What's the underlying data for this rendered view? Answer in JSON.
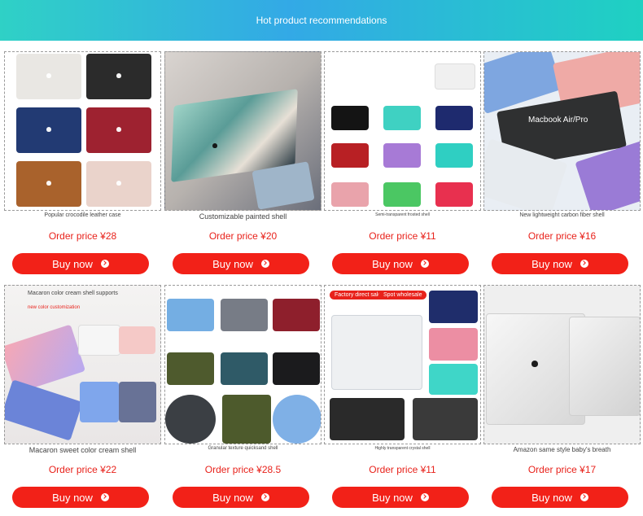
{
  "banner": {
    "title": "Hot product recommendations"
  },
  "products": [
    {
      "caption": "Popular crocodile leather case",
      "price": "Order price ¥28",
      "button": "Buy now"
    },
    {
      "caption": "Customizable painted shell",
      "price": "Order price ¥20",
      "button": "Buy now"
    },
    {
      "caption": "Semi-transparent frosted shell",
      "price": "Order price ¥11",
      "button": "Buy now"
    },
    {
      "caption": "New lightweight carbon fiber shell",
      "price": "Order price ¥16",
      "button": "Buy now"
    },
    {
      "caption": "Macaron sweet color cream shell",
      "price": "Order price ¥22",
      "button": "Buy now"
    },
    {
      "caption": "Granular texture quicksand shell",
      "price": "Order price ¥28.5",
      "button": "Buy now"
    },
    {
      "caption": "Highly transparent crystal shell",
      "price": "Order price ¥11",
      "button": "Buy now"
    },
    {
      "caption": "Amazon same style baby's breath",
      "price": "Order price ¥17",
      "button": "Buy now"
    }
  ],
  "photo_text": {
    "carbon_title": "Macbook Air/Pro",
    "macaron_line1": "Macaron color cream shell supports",
    "macaron_line2": "new color customization",
    "tag_factory": "Factory direct sales",
    "tag_wholesale": "Spot wholesale"
  },
  "colors": {
    "accent": "#f22118",
    "price": "#e8221b",
    "banner_start": "#2fd1c6",
    "banner_mid": "#33a9e6"
  }
}
